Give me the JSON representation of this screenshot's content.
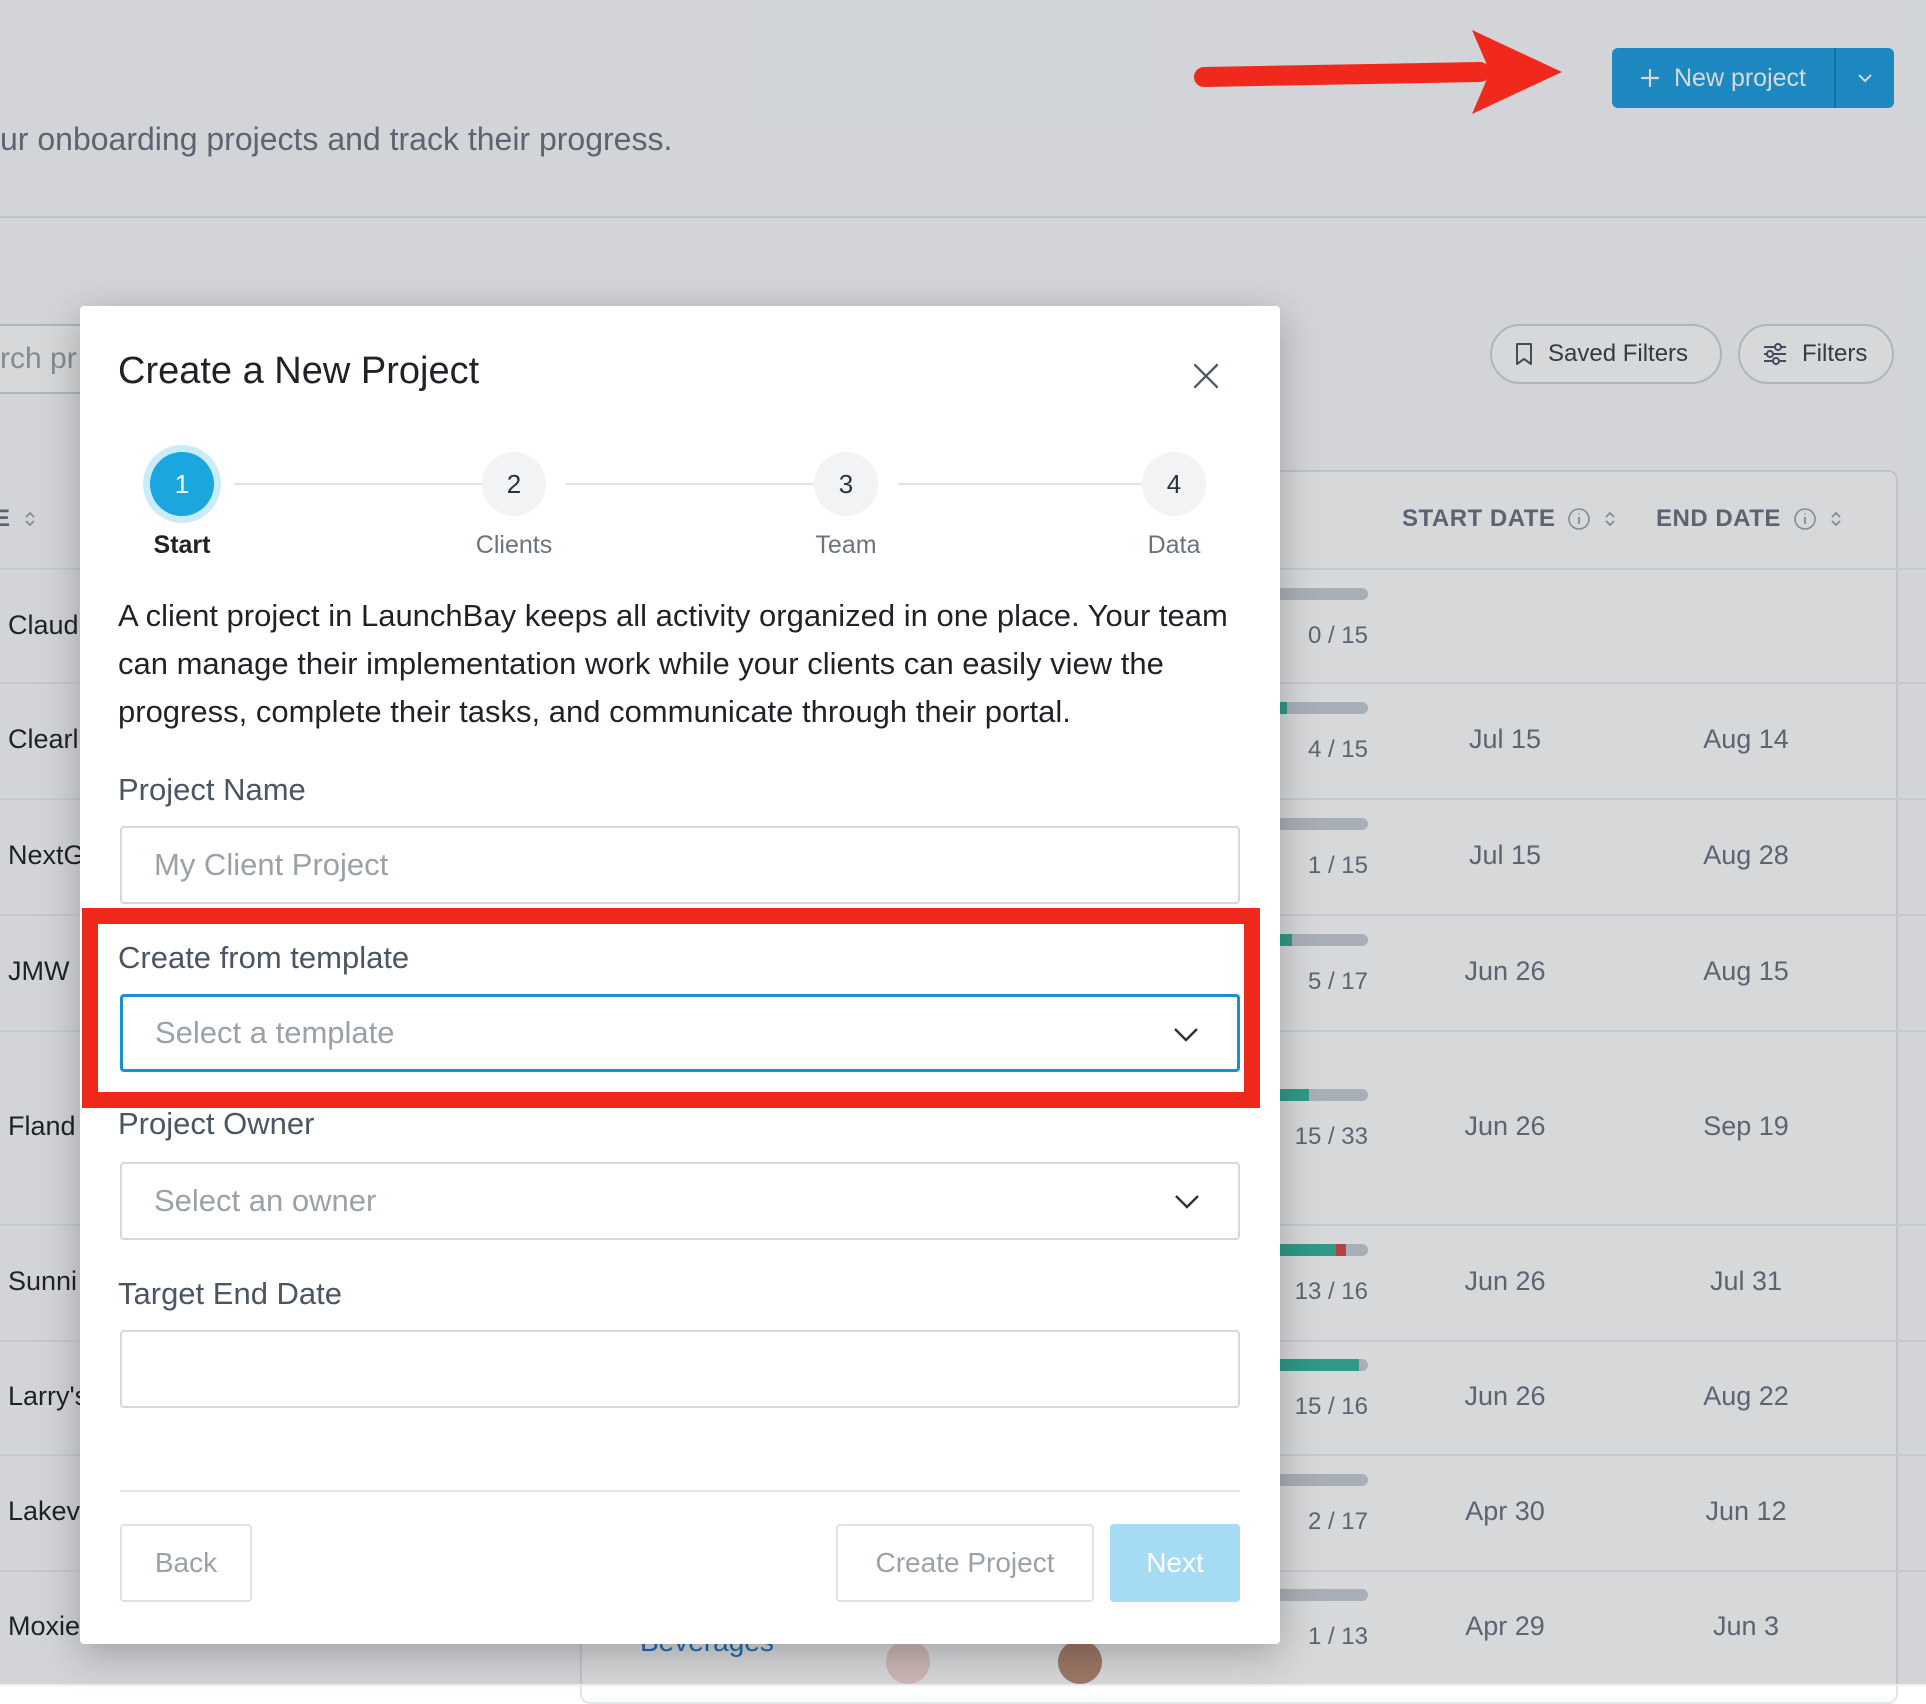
{
  "header": {
    "subtitle": "ur onboarding projects and track their progress.",
    "new_project_label": "New project"
  },
  "toolbar": {
    "search_text": "rch pr",
    "saved_filters_label": "Saved Filters",
    "filters_label": "Filters"
  },
  "table": {
    "columns": {
      "name_fragment": "E",
      "start_date": "START DATE",
      "end_date": "END DATE"
    },
    "rows": [
      {
        "name": "Claud",
        "progress": "0 / 15",
        "start": "",
        "end": "",
        "done": 0,
        "late": 0
      },
      {
        "name": "Clearl",
        "progress": "4 / 15",
        "start": "Jul 15",
        "end": "Aug 14",
        "done": 0.25,
        "late": 0
      },
      {
        "name": "NextG",
        "progress": "1 / 15",
        "start": "Jul 15",
        "end": "Aug 28",
        "done": 0.05,
        "late": 0
      },
      {
        "name": "JMW",
        "progress": "5 / 17",
        "start": "Jun 26",
        "end": "Aug 15",
        "done": 0.3,
        "late": 0
      },
      {
        "name": "Fland",
        "progress": "15 / 33",
        "start": "Jun 26",
        "end": "Sep 19",
        "done": 0.45,
        "late": 0
      },
      {
        "name": "Sunni",
        "progress": "13 / 16",
        "start": "Jun 26",
        "end": "Jul 31",
        "done": 0.7,
        "late": 0.1
      },
      {
        "name": "Larry's",
        "progress": "15 / 16",
        "start": "Jun 26",
        "end": "Aug 22",
        "done": 0.92,
        "late": 0
      },
      {
        "name": "Lakev",
        "progress": "2 / 17",
        "start": "Apr 30",
        "end": "Jun 12",
        "done": 0.1,
        "late": 0
      },
      {
        "name": "Moxie",
        "progress": "1 / 13",
        "start": "Apr 29",
        "end": "Jun 3",
        "done": 0.05,
        "late": 0
      }
    ],
    "client_link": "Beverages"
  },
  "modal": {
    "title": "Create a New Project",
    "steps": [
      {
        "number": "1",
        "label": "Start"
      },
      {
        "number": "2",
        "label": "Clients"
      },
      {
        "number": "3",
        "label": "Team"
      },
      {
        "number": "4",
        "label": "Data"
      }
    ],
    "intro": "A client project in LaunchBay keeps all activity organized in one place. Your team can manage their implementation work while your clients can easily view the progress, complete their tasks, and communicate through their portal.",
    "project_name": {
      "label": "Project Name",
      "placeholder": "My Client Project",
      "value": ""
    },
    "template": {
      "label": "Create from template",
      "placeholder": "Select a template"
    },
    "owner": {
      "label": "Project Owner",
      "placeholder": "Select an owner"
    },
    "target_end_date": {
      "label": "Target End Date",
      "value": ""
    },
    "buttons": {
      "back": "Back",
      "create": "Create Project",
      "next": "Next"
    }
  },
  "colors": {
    "accent": "#1aa6df",
    "annotation": "#f1291c",
    "progress_done": "#35b39a",
    "progress_late": "#d94848"
  }
}
